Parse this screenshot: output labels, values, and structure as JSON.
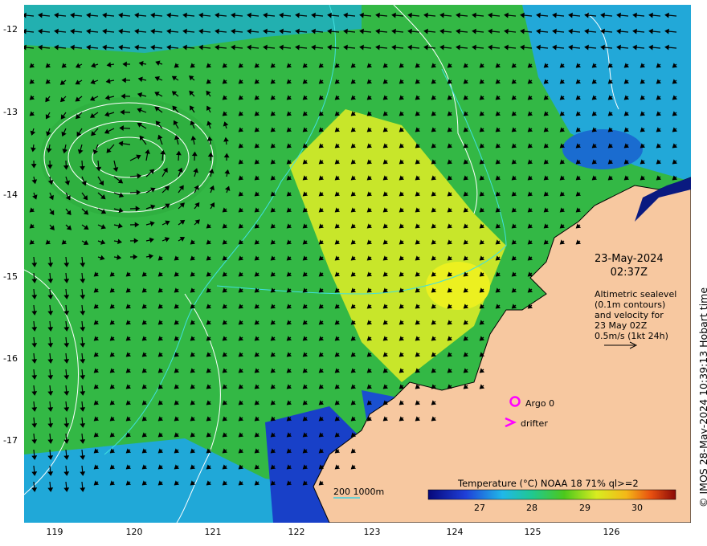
{
  "map": {
    "y_ticks": [
      "-12",
      "-13",
      "-14",
      "-15",
      "-16",
      "-17"
    ],
    "x_ticks": [
      "119",
      "120",
      "121",
      "122",
      "123",
      "124",
      "125",
      "126"
    ],
    "date_line1": "23-May-2024",
    "date_line2": "02:37Z",
    "altimetry_lines": [
      "Altimetric sealevel",
      "(0.1m contours)",
      "and velocity for",
      "23 May 02Z",
      "0.5m/s (1kt 24h)"
    ],
    "copyright": "© IMOS 28-May-2024 10:39:13 Hobart time",
    "colorbar_title": "Temperature (°C) NOAA 18 71% ql>=2",
    "colorbar_ticks": [
      "27",
      "28",
      "29",
      "30"
    ],
    "scale_text": "200  1000m",
    "legend_argo": "Argo 0",
    "legend_drifter": "drifter",
    "colors": {
      "land": "#f7c8a0",
      "warm": "#e8f020",
      "mid": "#3fbf3f",
      "cool": "#1aa0e0",
      "argo": "#ff00ff"
    },
    "icons": [
      "argo-float-marker-icon",
      "drifter-marker-icon",
      "velocity-arrow-icon"
    ]
  }
}
